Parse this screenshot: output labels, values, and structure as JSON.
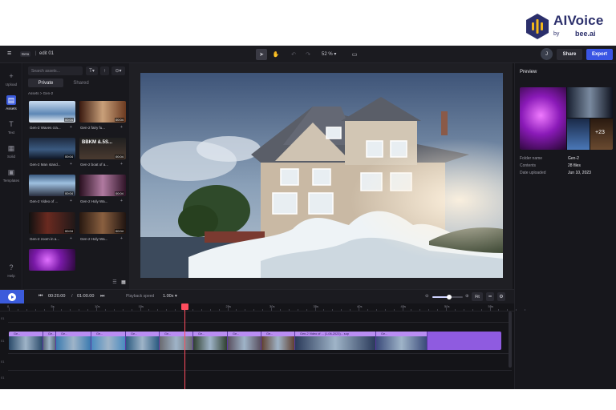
{
  "brand": {
    "name": "AIVoice",
    "by": "by",
    "partner": "bee.ai",
    "colors": {
      "navy": "#2b2f6b",
      "yellow": "#f3b71a"
    }
  },
  "topbar": {
    "menu_icon": "hamburger-icon",
    "project_badge": "Beta",
    "project_name": "edit 01",
    "zoom": "52 %",
    "avatar_initial": "J",
    "share_label": "Share",
    "export_label": "Export"
  },
  "rail": [
    {
      "label": "Upload",
      "icon": "plus-icon"
    },
    {
      "label": "Assets",
      "icon": "folder-icon",
      "active": true
    },
    {
      "label": "Text",
      "icon": "text-icon"
    },
    {
      "label": "Solid",
      "icon": "grid-icon"
    },
    {
      "label": "Templates",
      "icon": "template-icon"
    }
  ],
  "rail_help": "Help",
  "assets": {
    "search_placeholder": "Search assets...",
    "tabs": [
      "Private",
      "Shared"
    ],
    "breadcrumb": "Assets  >  Gen-2",
    "items": [
      {
        "title": "Gen-2 Waves cra...",
        "duration": "00:04"
      },
      {
        "title": "Gen-2 fairy fu...",
        "duration": "00:04"
      },
      {
        "title": "Gen-2 Man stand...",
        "duration": "00:04"
      },
      {
        "title": "Gen-2 boat of a...",
        "duration": "00:04"
      },
      {
        "title": "Gen-2 Video of ...",
        "duration": "00:04"
      },
      {
        "title": "Gen-2 Holy Wa...",
        "duration": "00:04"
      },
      {
        "title": "Gen-2 zoom in a...",
        "duration": "00:04"
      },
      {
        "title": "Gen-2 Holy Wa...",
        "duration": "00:04"
      },
      {
        "title": "",
        "duration": ""
      }
    ],
    "overlay_text": "BBKM &.5S..."
  },
  "preview": {
    "title": "Preview",
    "more_count": "+23",
    "fields": [
      {
        "key": "Folder name",
        "value": "Gen-2"
      },
      {
        "key": "Contents",
        "value": "28 files"
      },
      {
        "key": "Date uploaded",
        "value": "Jun 10, 2023"
      }
    ]
  },
  "transport": {
    "current_time": "00:20.00",
    "separator": "/",
    "total_time": "01:00.00",
    "speed_label": "Playback speed",
    "speed_value": "1.00x",
    "fit_label": "Fit",
    "zoom_level": 0.55
  },
  "timeline": {
    "ruler": [
      "0",
      "5s",
      "10s",
      "15s",
      "20s",
      "25s",
      "30s",
      "35s",
      "40s",
      "45s",
      "50s",
      "55s"
    ],
    "tracks": [
      "01",
      "01",
      "01",
      "01"
    ],
    "clip_labels": [
      "Ge...",
      "Ge...",
      "Ge...",
      "Ge...",
      "Ge...",
      "Ge...",
      "Ge...",
      "Ge...",
      "Ge...",
      "Gen-2 Video of ... (1-06-2023)... sup",
      "Ge..."
    ],
    "playhead_time": "20s"
  }
}
